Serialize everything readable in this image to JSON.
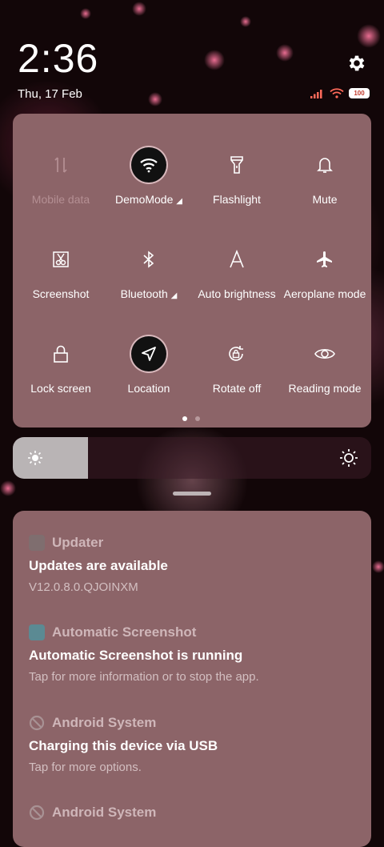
{
  "status_bar": {
    "time": "2:36",
    "date": "Thu, 17 Feb",
    "battery": "100",
    "icons": [
      "gear-icon",
      "signal-icon",
      "wifi-icon",
      "battery-icon"
    ]
  },
  "quick_settings": {
    "tiles": [
      {
        "label": "Mobile data",
        "icon": "mobile-data-icon",
        "state": "disabled"
      },
      {
        "label": "DemoMode",
        "icon": "wifi-icon",
        "state": "on",
        "has_dropdown": true
      },
      {
        "label": "Flashlight",
        "icon": "flashlight-icon",
        "state": "off"
      },
      {
        "label": "Mute",
        "icon": "bell-icon",
        "state": "off"
      },
      {
        "label": "Screenshot",
        "icon": "screenshot-icon",
        "state": "off"
      },
      {
        "label": "Bluetooth",
        "icon": "bluetooth-icon",
        "state": "off",
        "has_dropdown": true
      },
      {
        "label": "Auto brightness",
        "icon": "auto-brightness-icon",
        "state": "off"
      },
      {
        "label": "Aeroplane mode",
        "icon": "airplane-icon",
        "state": "off"
      },
      {
        "label": "Lock screen",
        "icon": "lock-icon",
        "state": "off"
      },
      {
        "label": "Location",
        "icon": "location-icon",
        "state": "on"
      },
      {
        "label": "Rotate off",
        "icon": "rotate-lock-icon",
        "state": "off"
      },
      {
        "label": "Reading mode",
        "icon": "eye-icon",
        "state": "off"
      }
    ],
    "page_count": 2,
    "current_page": 1
  },
  "brightness": {
    "level": 0.21
  },
  "notifications": [
    {
      "app": "Updater",
      "title": "Updates are available",
      "text": "V12.0.8.0.QJOINXM",
      "icon": "updater-icon"
    },
    {
      "app": "Automatic Screenshot",
      "title": "Automatic Screenshot is running",
      "text": "Tap for more information or to stop the app.",
      "icon": "screenshot-app-icon"
    },
    {
      "app": "Android System",
      "title": "Charging this device via USB",
      "text": "Tap for more options.",
      "icon": "android-system-icon"
    },
    {
      "app": "Android System",
      "title": "",
      "text": "",
      "icon": "android-system-icon"
    }
  ],
  "colors": {
    "panel": "#8c6468",
    "active_tile": "#111111",
    "brightness_fill": "#b9b4b5"
  }
}
